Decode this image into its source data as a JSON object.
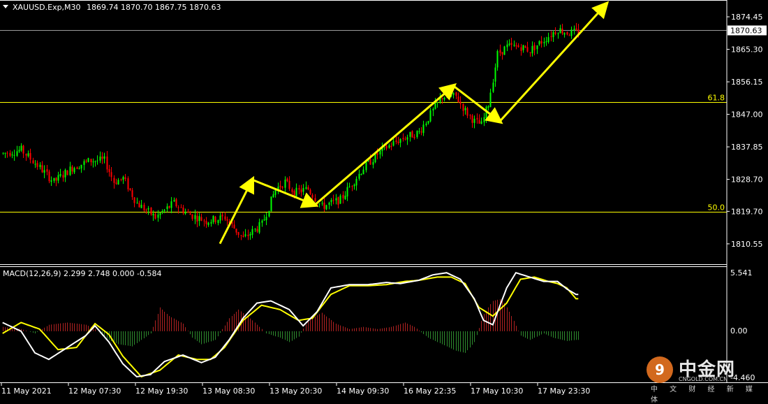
{
  "header": {
    "symbol_label": "XAUUSD.Exp,M30",
    "ohlc": "1869.74 1870.70 1867.75 1870.63"
  },
  "macd": {
    "label": "MACD(12,26,9) 2.299 2.748 0.000 -0.584",
    "axis_top": "5.541",
    "axis_zero": "0.00",
    "axis_bottom": "-4.460"
  },
  "colors": {
    "background": "#000000",
    "bull_candle": "#00ff00",
    "bear_candle": "#ff0000",
    "fib_line": "#ffff00",
    "arrow": "#ffff00",
    "macd_line": "#ffffff",
    "signal_line": "#ffff00",
    "hist_pos": "#b22222",
    "hist_neg": "#2e8b2e"
  },
  "watermark": {
    "cn": "中金网",
    "en": "CNGOLD.COM.CN",
    "sub": "中 文 财 经 新 媒 体",
    "logo_icon": "cngold-logo-icon"
  },
  "chart_data": [
    {
      "type": "candlestick",
      "series_name": "XAUUSD.Exp,M30",
      "ylim": [
        1806,
        1878
      ],
      "y_ticks": [
        1874.45,
        1865.3,
        1856.15,
        1847.0,
        1837.85,
        1828.7,
        1819.7,
        1810.55
      ],
      "y_tick_labels": [
        "1874.45",
        "1865.30",
        "1856.15",
        "1847.00",
        "1837.85",
        "1828.70",
        "1819.70",
        "1810.55"
      ],
      "current_price": 1870.63,
      "current_price_label": "1870.63",
      "fib_levels": [
        {
          "label": "61.8",
          "value": 1850.4
        },
        {
          "label": "50.0",
          "value": 1819.5
        }
      ],
      "x_labels": [
        "11 May 2021",
        "12 May 07:30",
        "12 May 19:30",
        "13 May 08:30",
        "13 May 20:30",
        "14 May 09:30",
        "16 May 22:35",
        "17 May 10:30",
        "17 May 23:30"
      ],
      "price_path": [
        [
          0,
          1836
        ],
        [
          8,
          1837
        ],
        [
          16,
          1832
        ],
        [
          22,
          1828
        ],
        [
          30,
          1832
        ],
        [
          38,
          1834
        ],
        [
          44,
          1834
        ],
        [
          48,
          1828
        ],
        [
          52,
          1829
        ],
        [
          58,
          1822
        ],
        [
          66,
          1818
        ],
        [
          74,
          1822
        ],
        [
          80,
          1819
        ],
        [
          88,
          1817
        ],
        [
          96,
          1818
        ],
        [
          104,
          1812
        ],
        [
          112,
          1816
        ],
        [
          118,
          1826
        ],
        [
          122,
          1828
        ],
        [
          126,
          1825
        ],
        [
          132,
          1826
        ],
        [
          138,
          1821
        ],
        [
          146,
          1823
        ],
        [
          156,
          1832
        ],
        [
          164,
          1837
        ],
        [
          172,
          1840
        ],
        [
          180,
          1842
        ],
        [
          186,
          1848
        ],
        [
          190,
          1852
        ],
        [
          196,
          1852
        ],
        [
          200,
          1848
        ],
        [
          204,
          1845
        ],
        [
          207,
          1844
        ],
        [
          210,
          1850
        ],
        [
          214,
          1864
        ],
        [
          218,
          1866
        ],
        [
          224,
          1866
        ],
        [
          228,
          1865
        ],
        [
          234,
          1868
        ],
        [
          240,
          1871
        ],
        [
          244,
          1870
        ],
        [
          248,
          1870
        ]
      ],
      "arrows": [
        {
          "from": [
            "13 May 08:30",
            1810.6
          ],
          "to": [
            "13 May 08:30",
            1828.6
          ]
        },
        {
          "from": [
            "13 May 08:30",
            1828.6
          ],
          "to": [
            "13 May 20:30",
            1821.5
          ]
        },
        {
          "from": [
            "13 May 20:30",
            1821.5
          ],
          "to": [
            "16 May 22:35",
            1855.0
          ]
        },
        {
          "from": [
            "16 May 22:35",
            1855.0
          ],
          "to": [
            "17 May 10:30",
            1845.0
          ]
        },
        {
          "from": [
            "17 May 10:30",
            1845.0
          ],
          "to": [
            "17 May 23:30",
            1878.0
          ]
        }
      ]
    },
    {
      "type": "macd",
      "series_name": "MACD(12,26,9)",
      "ylim": [
        -4.46,
        5.541
      ],
      "zero": 0,
      "macd_path": [
        [
          0,
          0.8
        ],
        [
          8,
          0.0
        ],
        [
          14,
          -2.0
        ],
        [
          20,
          -2.6
        ],
        [
          28,
          -1.5
        ],
        [
          36,
          -0.4
        ],
        [
          40,
          0.5
        ],
        [
          46,
          -1.0
        ],
        [
          52,
          -3.0
        ],
        [
          58,
          -4.2
        ],
        [
          64,
          -4.0
        ],
        [
          70,
          -2.8
        ],
        [
          78,
          -2.2
        ],
        [
          86,
          -2.9
        ],
        [
          92,
          -2.4
        ],
        [
          98,
          -0.8
        ],
        [
          104,
          1.2
        ],
        [
          110,
          2.6
        ],
        [
          116,
          2.8
        ],
        [
          124,
          2.0
        ],
        [
          130,
          0.5
        ],
        [
          136,
          1.8
        ],
        [
          142,
          4.0
        ],
        [
          150,
          4.3
        ],
        [
          158,
          4.3
        ],
        [
          166,
          4.5
        ],
        [
          172,
          4.4
        ],
        [
          180,
          4.7
        ],
        [
          186,
          5.2
        ],
        [
          192,
          5.4
        ],
        [
          198,
          4.8
        ],
        [
          204,
          3.0
        ],
        [
          208,
          1.0
        ],
        [
          212,
          0.6
        ],
        [
          218,
          4.0
        ],
        [
          222,
          5.4
        ],
        [
          228,
          5.0
        ],
        [
          234,
          4.6
        ],
        [
          240,
          4.6
        ],
        [
          244,
          3.9
        ],
        [
          248,
          3.4
        ]
      ],
      "signal_path": [
        [
          0,
          -0.2
        ],
        [
          8,
          0.8
        ],
        [
          16,
          0.2
        ],
        [
          24,
          -1.7
        ],
        [
          32,
          -1.5
        ],
        [
          40,
          0.7
        ],
        [
          46,
          -0.3
        ],
        [
          52,
          -2.3
        ],
        [
          60,
          -4.2
        ],
        [
          68,
          -3.6
        ],
        [
          76,
          -2.2
        ],
        [
          84,
          -2.6
        ],
        [
          90,
          -2.6
        ],
        [
          96,
          -1.5
        ],
        [
          104,
          1.0
        ],
        [
          112,
          2.4
        ],
        [
          120,
          2.0
        ],
        [
          128,
          1.0
        ],
        [
          134,
          1.2
        ],
        [
          142,
          3.4
        ],
        [
          150,
          4.2
        ],
        [
          158,
          4.2
        ],
        [
          166,
          4.3
        ],
        [
          174,
          4.6
        ],
        [
          180,
          4.7
        ],
        [
          188,
          5.0
        ],
        [
          194,
          5.0
        ],
        [
          200,
          4.4
        ],
        [
          206,
          2.2
        ],
        [
          212,
          1.4
        ],
        [
          218,
          2.6
        ],
        [
          224,
          4.8
        ],
        [
          230,
          5.0
        ],
        [
          236,
          4.6
        ],
        [
          240,
          4.4
        ],
        [
          244,
          4.0
        ],
        [
          248,
          3.0
        ]
      ],
      "histogram_path": [
        [
          0,
          0.4
        ],
        [
          8,
          0.2
        ],
        [
          14,
          -0.2
        ],
        [
          20,
          0.6
        ],
        [
          28,
          0.8
        ],
        [
          36,
          0.6
        ],
        [
          40,
          0.2
        ],
        [
          44,
          -0.6
        ],
        [
          50,
          -1.2
        ],
        [
          56,
          -1.4
        ],
        [
          64,
          -0.2
        ],
        [
          68,
          2.2
        ],
        [
          72,
          1.4
        ],
        [
          78,
          0.7
        ],
        [
          82,
          -0.6
        ],
        [
          86,
          -1.2
        ],
        [
          92,
          -0.8
        ],
        [
          98,
          1.2
        ],
        [
          102,
          2.0
        ],
        [
          108,
          1.0
        ],
        [
          114,
          -0.2
        ],
        [
          120,
          -0.6
        ],
        [
          124,
          -1.0
        ],
        [
          128,
          -0.5
        ],
        [
          132,
          1.0
        ],
        [
          138,
          1.7
        ],
        [
          144,
          0.7
        ],
        [
          150,
          0.2
        ],
        [
          156,
          0.4
        ],
        [
          162,
          0.2
        ],
        [
          168,
          0.4
        ],
        [
          174,
          0.8
        ],
        [
          178,
          0.4
        ],
        [
          184,
          -0.6
        ],
        [
          190,
          -1.2
        ],
        [
          196,
          -1.8
        ],
        [
          200,
          -2.0
        ],
        [
          204,
          -1.0
        ],
        [
          208,
          1.6
        ],
        [
          212,
          2.8
        ],
        [
          216,
          3.0
        ],
        [
          220,
          1.4
        ],
        [
          224,
          -0.4
        ],
        [
          228,
          -0.8
        ],
        [
          234,
          -0.2
        ],
        [
          238,
          -0.6
        ],
        [
          244,
          -0.9
        ],
        [
          248,
          -0.8
        ]
      ]
    }
  ]
}
